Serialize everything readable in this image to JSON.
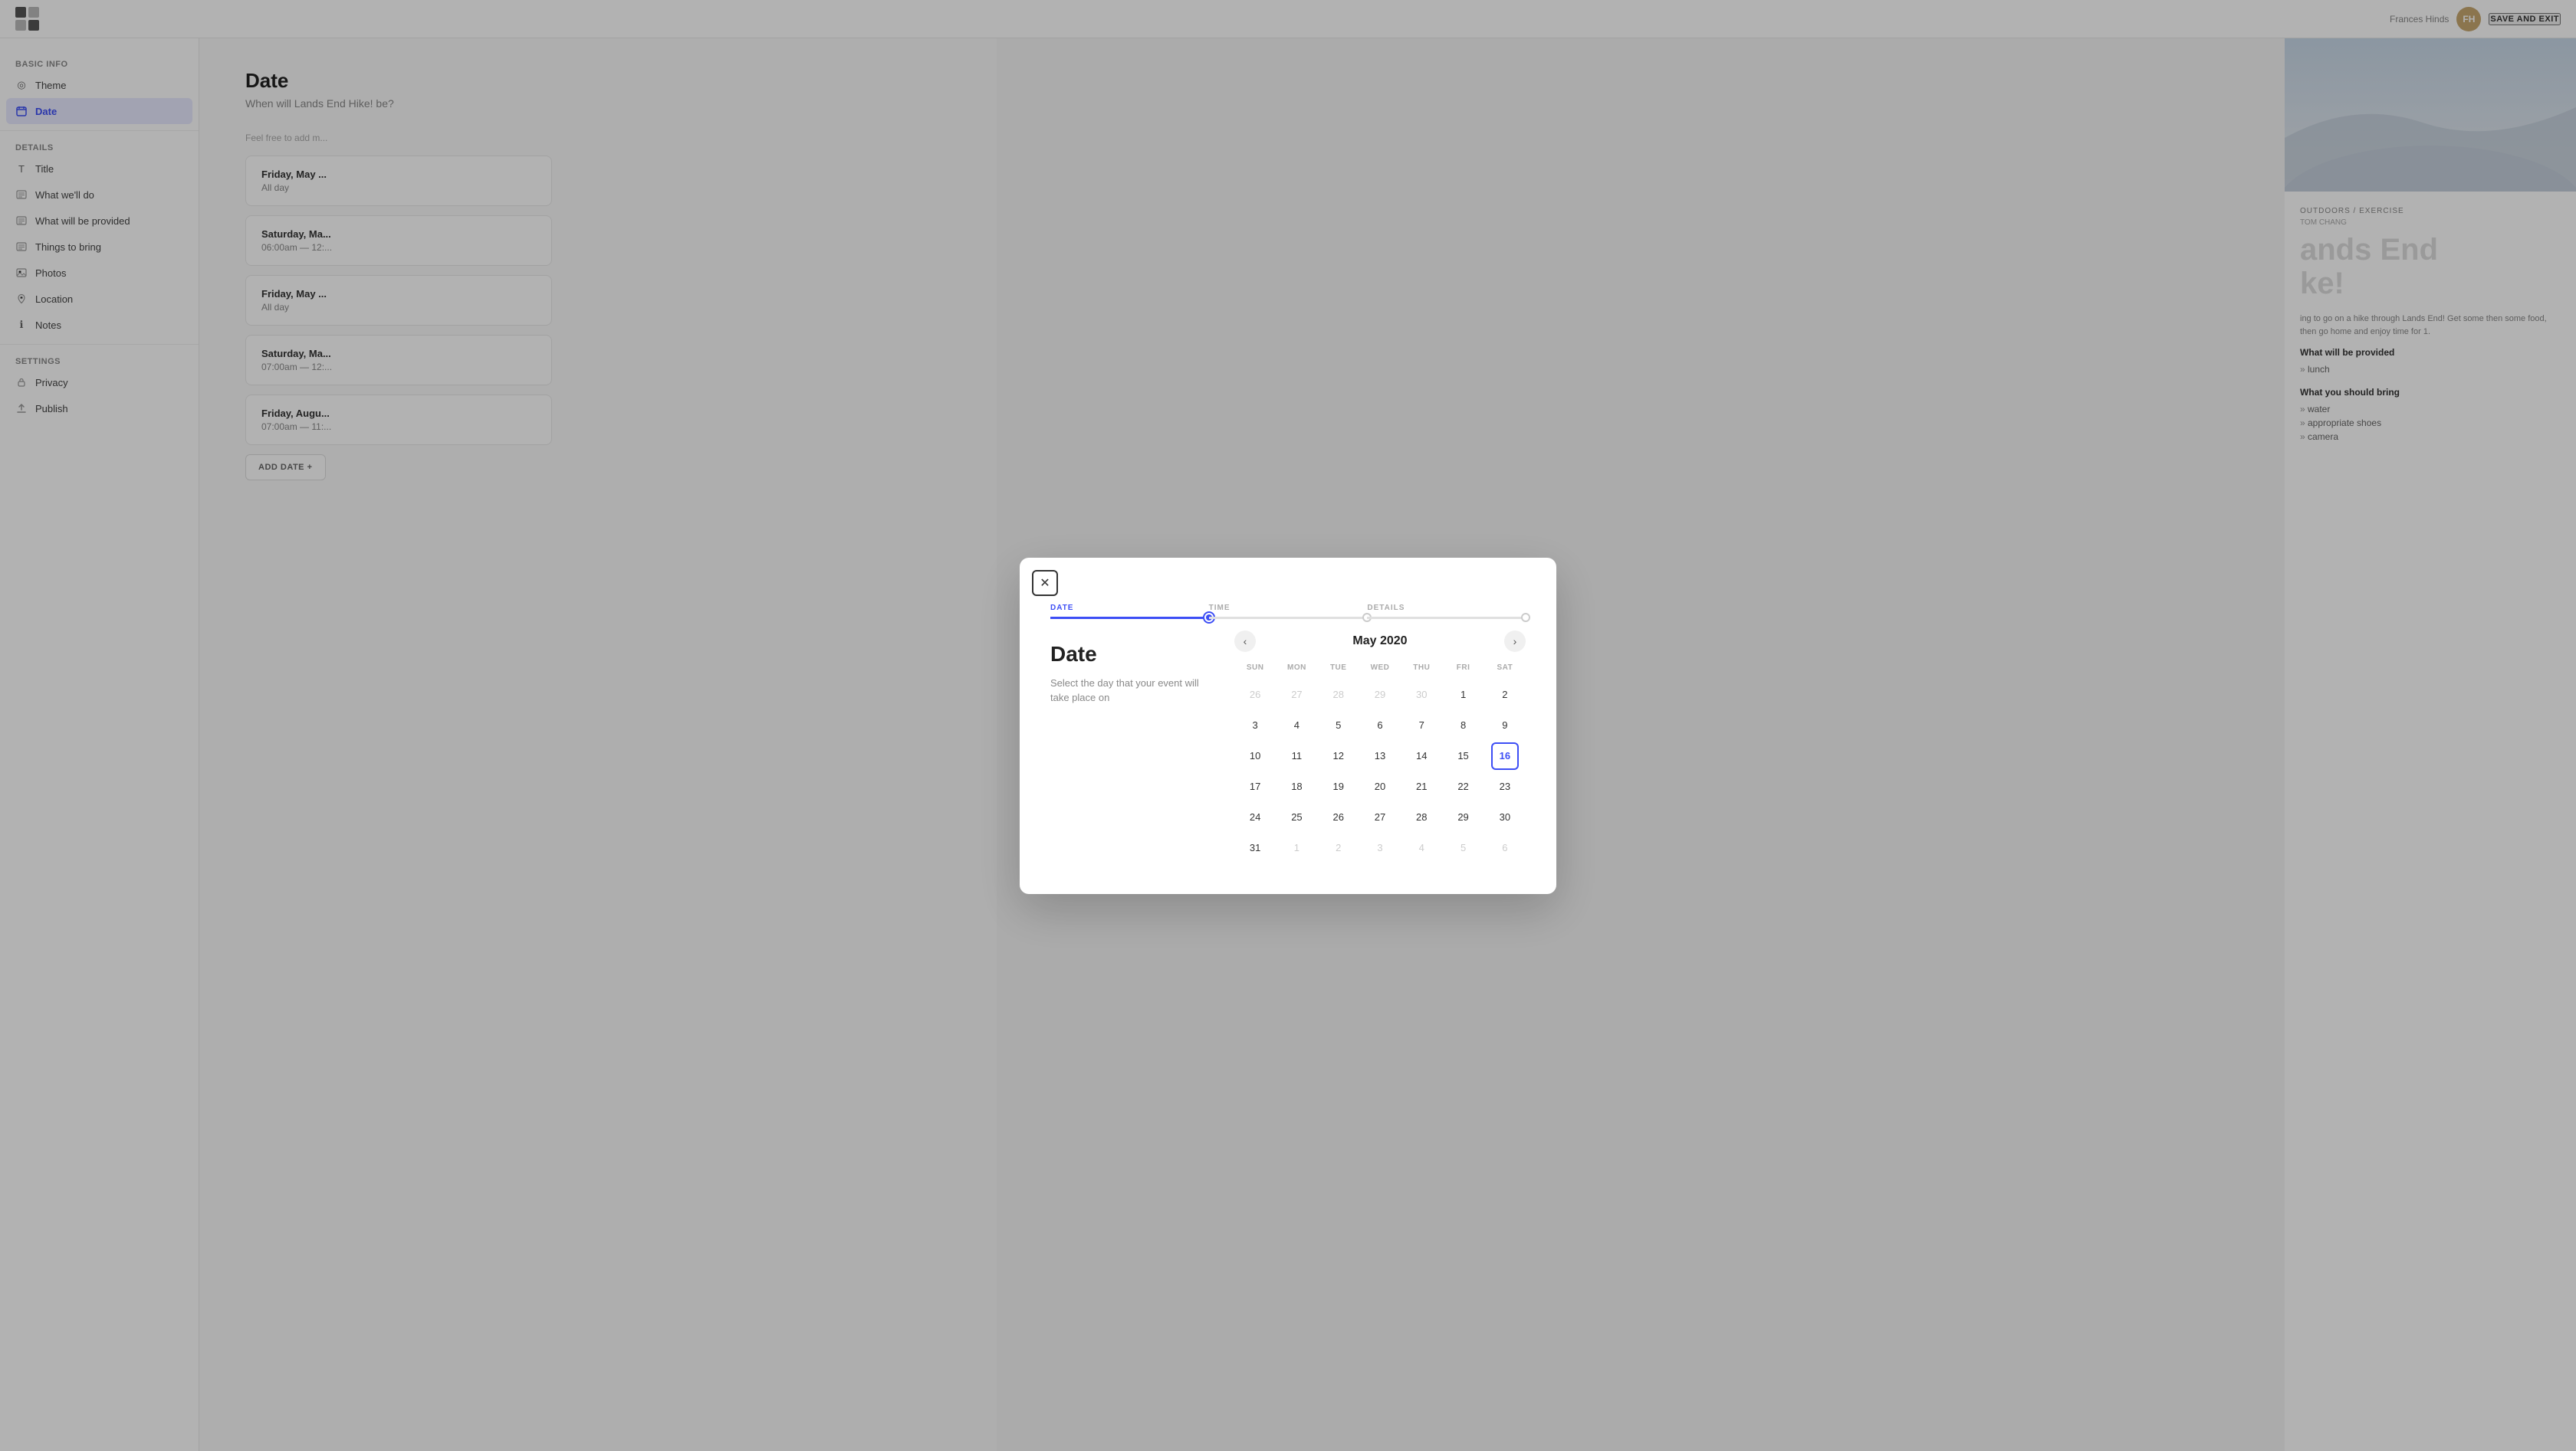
{
  "topbar": {
    "save_exit_label": "SAVE AND EXIT"
  },
  "sidebar": {
    "sections": [
      {
        "title": "Basic Info",
        "items": [
          {
            "id": "theme",
            "label": "Theme",
            "icon": "◎"
          },
          {
            "id": "date",
            "label": "Date",
            "icon": "⊞",
            "active": true
          }
        ]
      },
      {
        "title": "Details",
        "items": [
          {
            "id": "title",
            "label": "Title",
            "icon": "T"
          },
          {
            "id": "what-well-do",
            "label": "What we'll do",
            "icon": "☰"
          },
          {
            "id": "what-will-be-provided",
            "label": "What will be provided",
            "icon": "☰"
          },
          {
            "id": "things-to-bring",
            "label": "Things to bring",
            "icon": "☰"
          },
          {
            "id": "photos",
            "label": "Photos",
            "icon": "⬜"
          },
          {
            "id": "location",
            "label": "Location",
            "icon": "📍"
          },
          {
            "id": "notes",
            "label": "Notes",
            "icon": "ℹ"
          }
        ]
      },
      {
        "title": "Settings",
        "items": [
          {
            "id": "privacy",
            "label": "Privacy",
            "icon": "🔒"
          },
          {
            "id": "publish",
            "label": "Publish",
            "icon": "⬆"
          }
        ]
      }
    ]
  },
  "main": {
    "page_title": "Date",
    "page_subtitle": "When will Lands End Hike! be?",
    "hint_text": "Feel free to add m...",
    "dates": [
      {
        "main": "Friday, May ...",
        "sub": "All day"
      },
      {
        "main": "Saturday, Ma...",
        "sub": "06:00am — 12:..."
      },
      {
        "main": "Friday, May ...",
        "sub": "All day"
      },
      {
        "main": "Saturday, Ma...",
        "sub": "07:00am — 12:..."
      },
      {
        "main": "Friday, Augu...",
        "sub": "07:00am — 11:..."
      }
    ],
    "add_date_label": "ADD DATE  +"
  },
  "right_panel": {
    "tag_line": "OUTDOORS / EXERCISE",
    "author": "TOM CHANG",
    "big_title": "ands  End  ke!",
    "description": "ing to go on a hike through Lands End! Get some then some food, then go home and enjoy time for 1.",
    "what_will_be_provided_title": "What will be provided",
    "provided_items": [
      "lunch"
    ],
    "what_to_bring_title": "What you should bring",
    "bring_items": [
      "water",
      "appropriate shoes",
      "camera"
    ]
  },
  "modal": {
    "close_icon": "✕",
    "steps": [
      {
        "label": "DATE",
        "active": true,
        "filled": true
      },
      {
        "label": "TIME",
        "active": false,
        "filled": false
      },
      {
        "label": "DETAILS",
        "active": false,
        "filled": false
      }
    ],
    "left_title": "Date",
    "left_desc": "Select the day that your event will take place on",
    "calendar": {
      "month_year": "May 2020",
      "day_headers": [
        "SUN",
        "MON",
        "TUE",
        "WED",
        "THU",
        "FRI",
        "SAT"
      ],
      "weeks": [
        [
          {
            "day": "26",
            "other": true
          },
          {
            "day": "27",
            "other": true
          },
          {
            "day": "28",
            "other": true
          },
          {
            "day": "29",
            "other": true
          },
          {
            "day": "30",
            "other": true
          },
          {
            "day": "1",
            "other": false
          },
          {
            "day": "2",
            "other": false
          }
        ],
        [
          {
            "day": "3",
            "other": false
          },
          {
            "day": "4",
            "other": false
          },
          {
            "day": "5",
            "other": false
          },
          {
            "day": "6",
            "other": false
          },
          {
            "day": "7",
            "other": false
          },
          {
            "day": "8",
            "other": false
          },
          {
            "day": "9",
            "other": false
          }
        ],
        [
          {
            "day": "10",
            "other": false
          },
          {
            "day": "11",
            "other": false
          },
          {
            "day": "12",
            "other": false
          },
          {
            "day": "13",
            "other": false
          },
          {
            "day": "14",
            "other": false
          },
          {
            "day": "15",
            "other": false
          },
          {
            "day": "16",
            "other": false,
            "selected": true
          }
        ],
        [
          {
            "day": "17",
            "other": false
          },
          {
            "day": "18",
            "other": false
          },
          {
            "day": "19",
            "other": false
          },
          {
            "day": "20",
            "other": false
          },
          {
            "day": "21",
            "other": false
          },
          {
            "day": "22",
            "other": false
          },
          {
            "day": "23",
            "other": false
          }
        ],
        [
          {
            "day": "24",
            "other": false
          },
          {
            "day": "25",
            "other": false
          },
          {
            "day": "26",
            "other": false
          },
          {
            "day": "27",
            "other": false
          },
          {
            "day": "28",
            "other": false
          },
          {
            "day": "29",
            "other": false
          },
          {
            "day": "30",
            "other": false
          }
        ],
        [
          {
            "day": "31",
            "other": false
          },
          {
            "day": "1",
            "other": true
          },
          {
            "day": "2",
            "other": true
          },
          {
            "day": "3",
            "other": true
          },
          {
            "day": "4",
            "other": true
          },
          {
            "day": "5",
            "other": true
          },
          {
            "day": "6",
            "other": true
          }
        ]
      ]
    }
  },
  "profile": {
    "name": "Frances Hinds",
    "initials": "FH"
  },
  "colors": {
    "accent": "#3d4ef5",
    "selected_border": "#3d4ef5"
  }
}
